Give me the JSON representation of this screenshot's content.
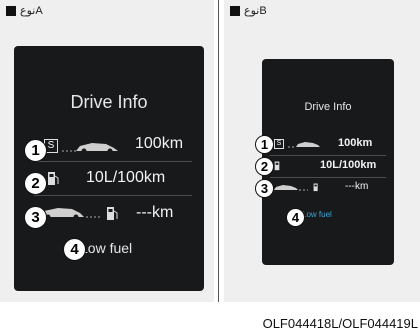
{
  "type_a_label": "نوعA",
  "type_b_label": "نوعB",
  "screen_a": {
    "title": "Drive Info",
    "row1_value": "100km",
    "row2_value": "10L/100km",
    "row3_value": "---km",
    "low_fuel": "Low fuel"
  },
  "screen_b": {
    "title": "Drive Info",
    "row1_value": "100km",
    "row2_value": "10L/100km",
    "row3_value": "---km",
    "low_fuel": "Low fuel"
  },
  "markers": [
    "1",
    "2",
    "3",
    "4"
  ],
  "caption": "OLF044418L/OLF044419L",
  "colors": {
    "screen_bg": "#17191b",
    "panel_bg": "#efefef",
    "low_fuel_b": "#3aa6d6"
  },
  "icons": [
    "car-icon",
    "fuel-pump-icon",
    "small-s-icon"
  ]
}
